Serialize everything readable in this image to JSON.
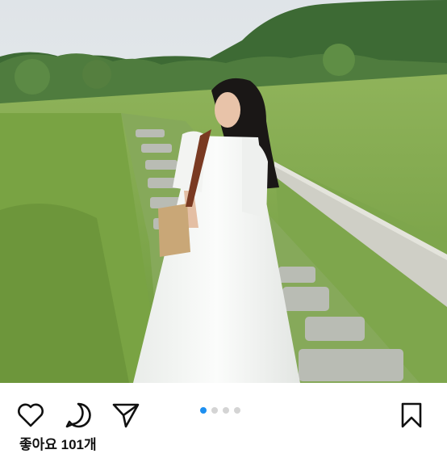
{
  "post": {
    "likes_text": "좋아요 101개",
    "carousel": {
      "total": 4,
      "current": 1
    }
  },
  "actions": [
    {
      "name": "like",
      "icon": "heart-icon"
    },
    {
      "name": "comment",
      "icon": "comment-bubble-icon"
    },
    {
      "name": "share",
      "icon": "paper-plane-icon"
    },
    {
      "name": "save",
      "icon": "bookmark-icon"
    }
  ],
  "colors": {
    "accent_dot": "#1d8ff0",
    "inactive_dot": "#d4d4d4",
    "icon": "#111111"
  }
}
